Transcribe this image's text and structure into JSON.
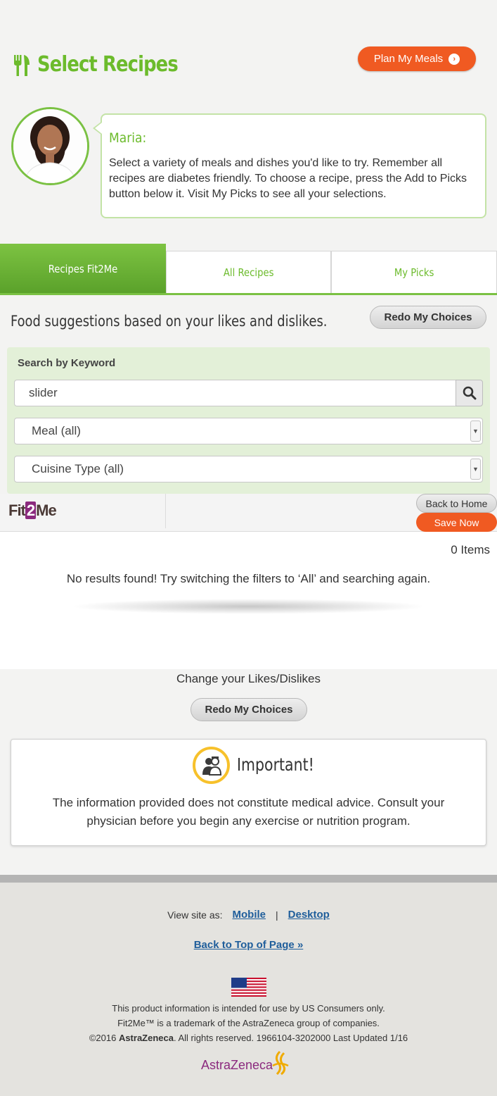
{
  "header": {
    "title": "Select Recipes",
    "plan_button": "Plan My Meals"
  },
  "coach": {
    "name": "Maria:",
    "message": "Select a variety of meals and dishes you'd like to try. Remember all recipes are diabetes friendly. To choose a recipe, press the Add to Picks button below it. Visit My Picks to see all your selections."
  },
  "tabs": [
    {
      "label": "Recipes Fit2Me",
      "active": true
    },
    {
      "label": "All Recipes",
      "active": false
    },
    {
      "label": "My Picks",
      "active": false
    }
  ],
  "suggestions": {
    "text": "Food suggestions based on your likes and dislikes.",
    "redo_button": "Redo My Choices"
  },
  "search": {
    "label": "Search by Keyword",
    "value": "slider",
    "meal_select": "Meal (all)",
    "cuisine_select": "Cuisine Type (all)"
  },
  "fit_bar": {
    "logo_pre": "Fit",
    "logo_mid": "2",
    "logo_post": "Me",
    "back_home": "Back to Home",
    "save_now": "Save Now"
  },
  "results": {
    "count": "0 Items",
    "empty_message": "No results found! Try switching the filters to ‘All’ and searching again."
  },
  "likes": {
    "label": "Change your Likes/Dislikes",
    "redo_button": "Redo My Choices"
  },
  "important": {
    "title": "Important!",
    "text": "The information provided does not constitute medical advice. Consult your physician before you begin any exercise or nutrition program."
  },
  "footer": {
    "view_label": "View site as:",
    "mobile": "Mobile",
    "separator": "|",
    "desktop": "Desktop",
    "back_top": "Back to Top of Page »",
    "line1": "This product information is intended for use by US Consumers only.",
    "line2": "Fit2Me™ is a trademark of the AstraZeneca group of companies.",
    "line3_pre": "©2016 ",
    "line3_brand": "AstraZeneca",
    "line3_post": ". All rights reserved. 1966104-3202000 Last Updated 1/16",
    "logo_text": "AstraZeneca"
  },
  "colors": {
    "brand_green": "#6cbb2c",
    "accent_orange": "#f05a22",
    "astrazeneca_purple": "#8b2a7e",
    "link_blue": "#1f5e9b"
  }
}
